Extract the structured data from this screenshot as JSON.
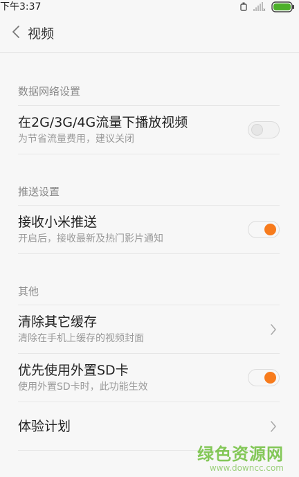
{
  "status": {
    "time": "下午3:37",
    "icons": [
      "alarm-icon",
      "signal-icon",
      "battery-icon"
    ],
    "battery_color": "#4caf2a"
  },
  "header": {
    "back_icon": "chevron-left-icon",
    "title": "视频"
  },
  "sections": [
    {
      "header": "数据网络设置",
      "items": [
        {
          "title": "在2G/3G/4G流量下播放视频",
          "subtitle": "为节省流量费用，建议关闭",
          "control": "toggle",
          "checked": false
        }
      ]
    },
    {
      "header": "推送设置",
      "items": [
        {
          "title": "接收小米推送",
          "subtitle": "开启后，接收最新及热门影片通知",
          "control": "toggle",
          "checked": true
        }
      ]
    },
    {
      "header": "其他",
      "items": [
        {
          "title": "清除其它缓存",
          "subtitle": "清除在手机上缓存的视频封面",
          "control": "chevron"
        },
        {
          "title": "优先使用外置SD卡",
          "subtitle": "使用外置SD卡时，此功能生效",
          "control": "toggle",
          "checked": true
        },
        {
          "title": "体验计划",
          "control": "chevron"
        }
      ]
    }
  ],
  "accent_color": "#f77b1c",
  "watermark": {
    "title": "绿色资源网",
    "url": "www.downcc.com"
  }
}
